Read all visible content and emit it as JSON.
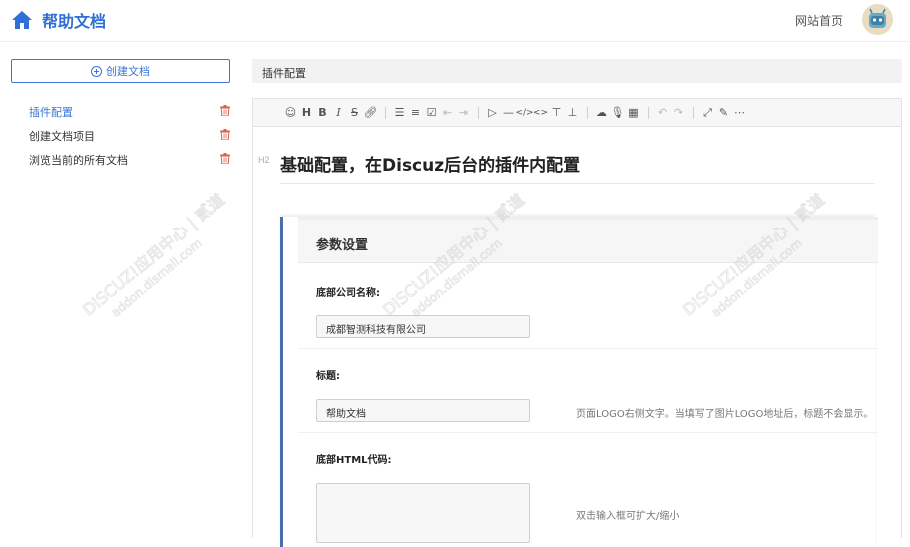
{
  "header": {
    "title": "帮助文档",
    "home_link": "网站首页"
  },
  "sidebar": {
    "create_label": "创建文档",
    "items": [
      {
        "label": "插件配置",
        "active": true
      },
      {
        "label": "创建文档项目",
        "active": false
      },
      {
        "label": "浏览当前的所有文档",
        "active": false
      }
    ]
  },
  "main": {
    "breadcrumb": "插件配置",
    "heading_tag": "H2",
    "heading": "基础配置，在Discuz后台的插件内配置",
    "panel_title": "参数设置",
    "fields": [
      {
        "label": "底部公司名称:",
        "value": "成都智测科技有限公司",
        "hint": ""
      },
      {
        "label": "标题:",
        "value": "帮助文档",
        "hint": "页面LOGO右侧文字。当填写了图片LOGO地址后，标题不会显示。"
      },
      {
        "label": "底部HTML代码:",
        "value": "",
        "hint": "双击输入框可扩大/缩小"
      }
    ]
  },
  "watermark": {
    "line1": "DISCUZ!应用中心 | 贰道",
    "line2": "addon.dismall.com"
  },
  "colors": {
    "accent": "#3b74d6",
    "trash": "#e05a4f",
    "panel_border": "#4a6ea8"
  }
}
